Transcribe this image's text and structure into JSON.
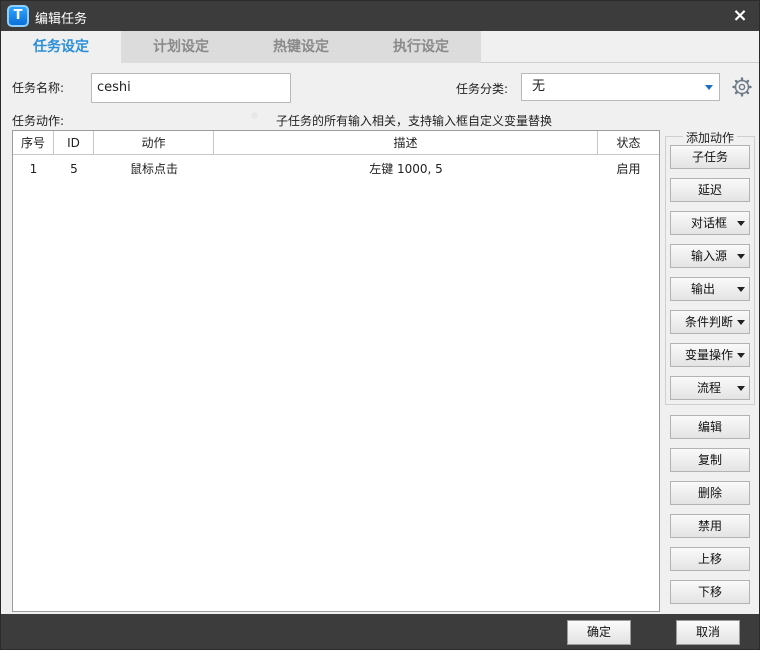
{
  "window": {
    "title": "编辑任务",
    "logo_letter": "T",
    "close_glyph": "×"
  },
  "tabs": [
    {
      "label": "任务设定",
      "active": true
    },
    {
      "label": "计划设定",
      "active": false
    },
    {
      "label": "热键设定",
      "active": false
    },
    {
      "label": "执行设定",
      "active": false
    }
  ],
  "form": {
    "name_label": "任务名称:",
    "name_value": "ceshi",
    "category_label": "任务分类:",
    "category_value": "无",
    "actions_label": "任务动作:",
    "hint": "子任务的所有输入相关，支持输入框自定义变量替换"
  },
  "table": {
    "columns": [
      "序号",
      "ID",
      "动作",
      "描述",
      "状态"
    ],
    "rows": [
      {
        "index": "1",
        "id": "5",
        "action": "鼠标点击",
        "desc": "左键 1000, 5",
        "status": "启用"
      }
    ]
  },
  "side": {
    "group_title": "添加动作",
    "add_buttons": [
      {
        "label": "子任务",
        "dropdown": false
      },
      {
        "label": "延迟",
        "dropdown": false
      },
      {
        "label": "对话框",
        "dropdown": true
      },
      {
        "label": "输入源",
        "dropdown": true
      },
      {
        "label": "输出",
        "dropdown": true
      },
      {
        "label": "条件判断",
        "dropdown": true
      },
      {
        "label": "变量操作",
        "dropdown": true
      },
      {
        "label": "流程",
        "dropdown": true
      }
    ],
    "edit_buttons": [
      {
        "label": "编辑"
      },
      {
        "label": "复制"
      },
      {
        "label": "删除"
      },
      {
        "label": "禁用"
      },
      {
        "label": "上移"
      },
      {
        "label": "下移"
      }
    ]
  },
  "footer": {
    "ok": "确定",
    "cancel": "取消"
  },
  "colors": {
    "titlebar": "#3c3c3c",
    "accent_tab": "#2b8fd8",
    "logo": "#0a6fd8"
  }
}
